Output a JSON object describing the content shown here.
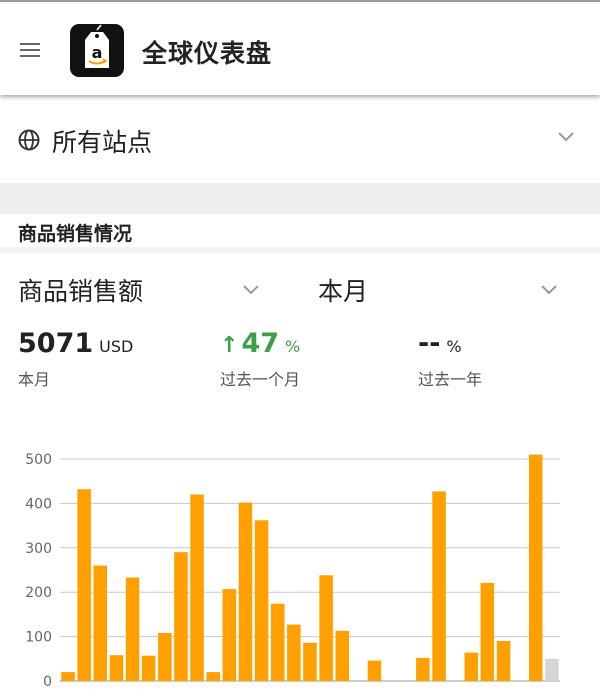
{
  "header": {
    "title": "全球仪表盘"
  },
  "site_selector": {
    "label": "所有站点"
  },
  "section": {
    "title": "商品销售情况"
  },
  "filters": {
    "metric": {
      "selected": "商品销售额"
    },
    "period": {
      "selected": "本月"
    }
  },
  "stats": {
    "current": {
      "value": "5071",
      "unit": "USD",
      "label": "本月"
    },
    "vs_month": {
      "arrow": "↑",
      "value": "47",
      "unit": "%",
      "label": "过去一个月",
      "color": "#3aa04a"
    },
    "vs_year": {
      "value": "--",
      "unit": "%",
      "label": "过去一年"
    }
  },
  "colors": {
    "bar": "#ff9f00",
    "bar_today": "#d5d5d5",
    "grid": "#c8c8c8",
    "positive": "#3aa04a"
  },
  "chart_data": {
    "type": "bar",
    "ylim": [
      0,
      500
    ],
    "yticks": [
      0,
      100,
      200,
      300,
      400,
      500
    ],
    "grid": true,
    "values": [
      20,
      432,
      260,
      58,
      233,
      57,
      108,
      290,
      420,
      20,
      207,
      402,
      362,
      174,
      127,
      86,
      238,
      113,
      0,
      46,
      0,
      0,
      52,
      427,
      0,
      64,
      221,
      90,
      0,
      510,
      50
    ],
    "highlight_last": true
  }
}
